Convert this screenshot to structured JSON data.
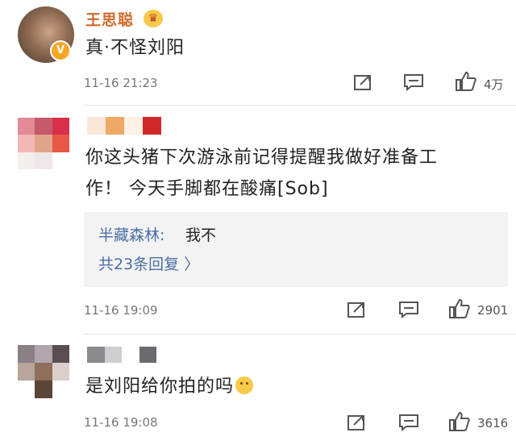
{
  "comments": [
    {
      "username": "王思聪",
      "text": "真·不怪刘阳",
      "time": "11-16 21:23",
      "likes": "4万"
    },
    {
      "text_line1": "你这头猪下次游泳前记得提醒我做好准备工",
      "text_line2": "作！ 今天手脚都在酸痛[Sob]",
      "reply_name": "半藏森林:",
      "reply_text": "我不",
      "reply_more": "共23条回复 〉",
      "time": "11-16 19:09",
      "likes": "2901"
    },
    {
      "text": "是刘阳给你拍的吗",
      "time": "11-16 19:08",
      "likes": "3616"
    }
  ],
  "icons": {
    "verified": "verified-v-badge-icon",
    "crown": "crown-badge-icon",
    "share": "share-icon",
    "comment": "comment-icon",
    "like": "thumbs-up-icon"
  },
  "colors": {
    "username": "#d26a2a",
    "reply_link": "#4a6fa5",
    "meta": "#777777"
  }
}
